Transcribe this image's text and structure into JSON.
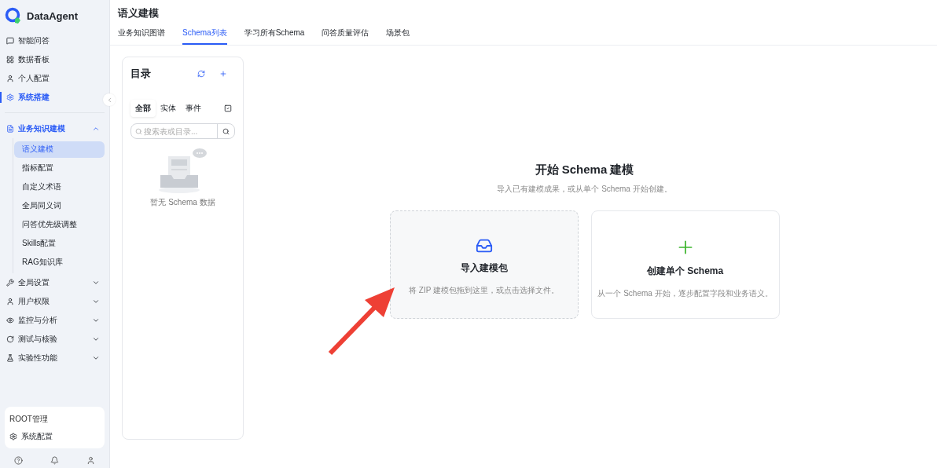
{
  "brand": {
    "name": "DataAgent"
  },
  "sidebar": {
    "items": [
      {
        "label": "智能问答",
        "selected": false
      },
      {
        "label": "数据看板",
        "selected": false
      },
      {
        "label": "个人配置",
        "selected": false
      },
      {
        "label": "系统搭建",
        "selected": true
      }
    ],
    "groups": [
      {
        "label": "业务知识建模",
        "expanded": true,
        "children": [
          {
            "label": "语义建模",
            "selected": true
          },
          {
            "label": "指标配置",
            "selected": false
          },
          {
            "label": "自定义术语",
            "selected": false
          },
          {
            "label": "全局同义词",
            "selected": false
          },
          {
            "label": "问答优先级调整",
            "selected": false
          },
          {
            "label": "Skills配置",
            "selected": false
          },
          {
            "label": "RAG知识库",
            "selected": false
          }
        ]
      },
      {
        "label": "全局设置",
        "expanded": false
      },
      {
        "label": "用户权限",
        "expanded": false
      },
      {
        "label": "监控与分析",
        "expanded": false
      },
      {
        "label": "测试与核验",
        "expanded": false
      },
      {
        "label": "实验性功能",
        "expanded": false
      }
    ],
    "footer": {
      "section_title": "ROOT管理",
      "item": "系统配置"
    }
  },
  "page": {
    "title": "语义建模",
    "tabs": [
      {
        "label": "业务知识图谱",
        "selected": false
      },
      {
        "label": "Schema列表",
        "selected": true
      },
      {
        "label": "学习所有Schema",
        "selected": false
      },
      {
        "label": "问答质量评估",
        "selected": false
      },
      {
        "label": "场景包",
        "selected": false
      }
    ]
  },
  "catalog": {
    "title": "目录",
    "filters": [
      {
        "label": "全部",
        "selected": true
      },
      {
        "label": "实体",
        "selected": false
      },
      {
        "label": "事件",
        "selected": false
      }
    ],
    "search": {
      "placeholder": "搜索表或目录..."
    },
    "empty_text": "暂无 Schema 数据"
  },
  "start": {
    "title": "开始 Schema 建模",
    "subtitle": "导入已有建模成果，或从单个 Schema 开始创建。",
    "cards": [
      {
        "kind": "import",
        "title": "导入建模包",
        "description": "将 ZIP 建模包拖到这里，或点击选择文件。"
      },
      {
        "kind": "create",
        "title": "创建单个 Schema",
        "description": "从一个 Schema 开始，逐步配置字段和业务语义。"
      }
    ]
  }
}
